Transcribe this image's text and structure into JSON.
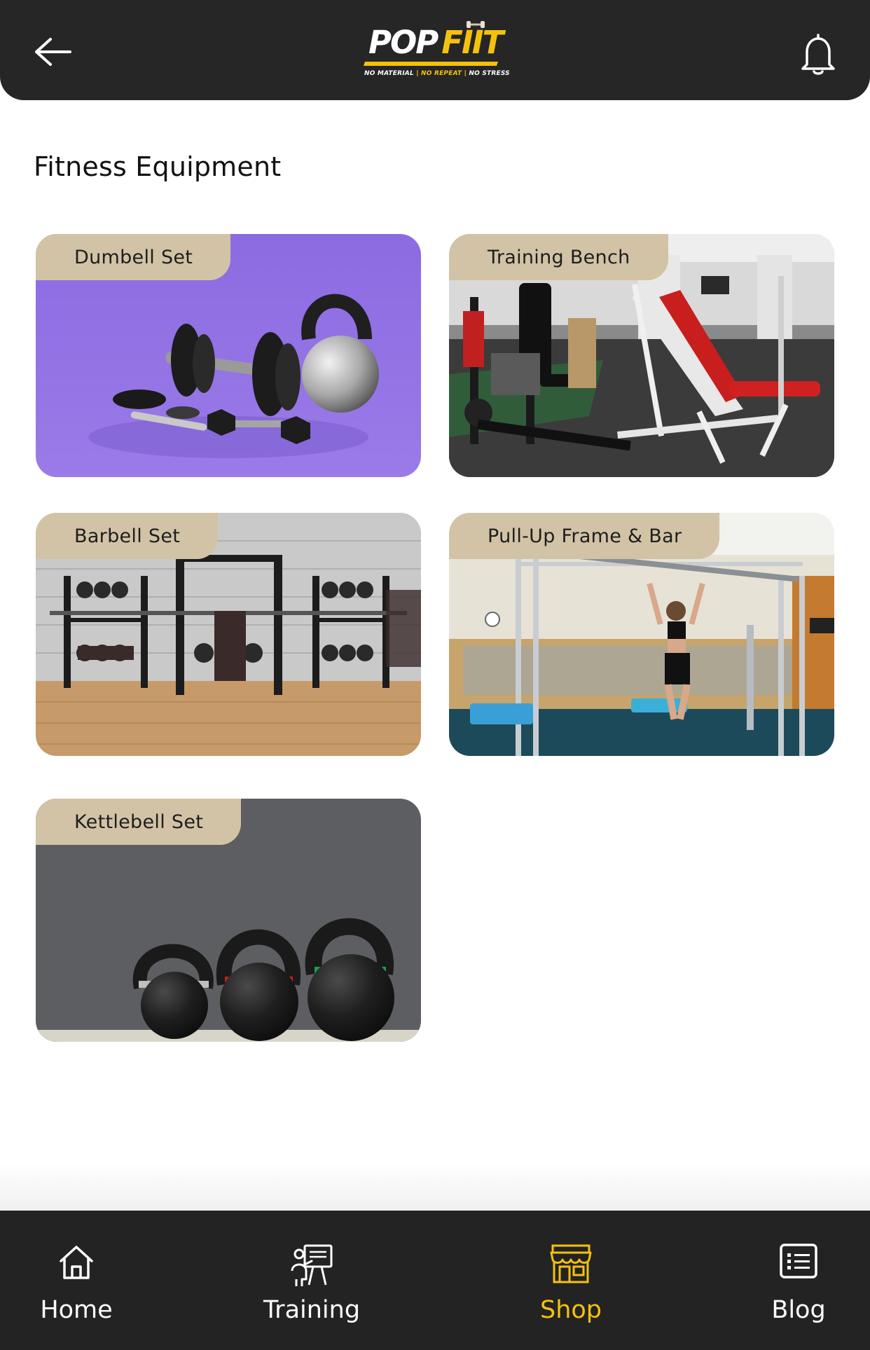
{
  "header": {
    "back_icon": "arrow-left-icon",
    "notification_icon": "bell-icon",
    "logo": {
      "pop": "POP",
      "fiit": "FIIT",
      "tagline": [
        "NO MATERIAL",
        "NO REPEAT",
        "NO STRESS"
      ]
    }
  },
  "page": {
    "title": "Fitness Equipment"
  },
  "products": [
    {
      "label": "Dumbell Set"
    },
    {
      "label": "Training Bench"
    },
    {
      "label": "Barbell Set"
    },
    {
      "label": "Pull-Up Frame & Bar"
    },
    {
      "label": "Kettlebell Set"
    }
  ],
  "bottom_nav": {
    "items": [
      {
        "label": "Home",
        "icon": "home-icon"
      },
      {
        "label": "Training",
        "icon": "trainer-board-icon"
      },
      {
        "label": "Shop",
        "icon": "store-icon",
        "active": true
      },
      {
        "label": "Blog",
        "icon": "list-icon"
      }
    ]
  },
  "colors": {
    "header_bg": "#262626",
    "nav_bg": "#232323",
    "accent": "#f4c20d",
    "tag_bg": "#d2c3a6"
  }
}
